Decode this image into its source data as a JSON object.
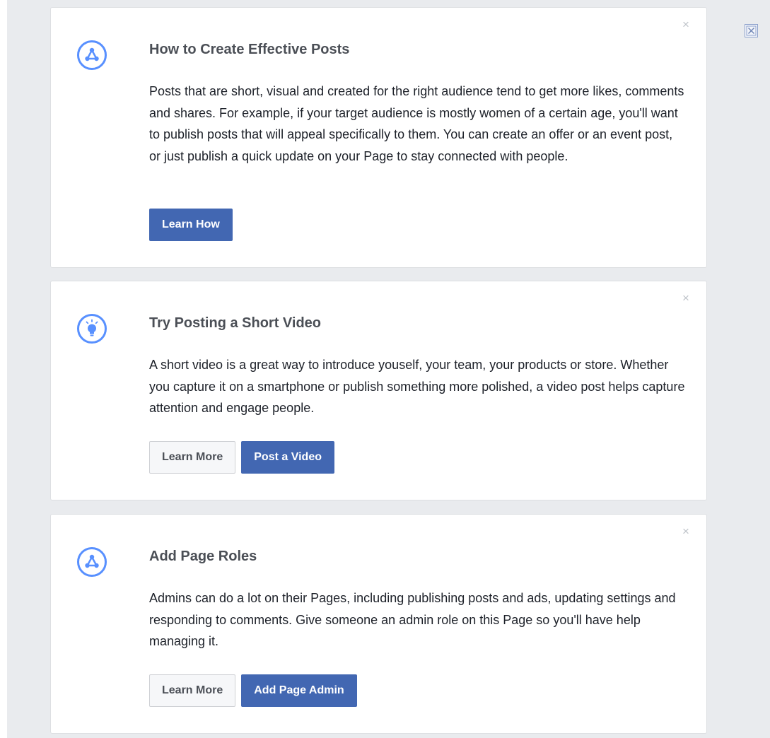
{
  "colors": {
    "background": "#e9ebee",
    "card": "#ffffff",
    "accent": "#4267b2",
    "icon_blue": "#5890ff",
    "title": "#4b4f56",
    "dismiss": "#bec3c9"
  },
  "global_close": {
    "icon": "close-box-icon"
  },
  "cards": [
    {
      "icon": "share-nodes-icon",
      "title": "How to Create Effective Posts",
      "body": "Posts that are short, visual and created for the right audience tend to get more likes, comments and shares. For example, if your target audience is mostly women of a certain age, you'll want to publish posts that will appeal specifically to them. You can create an offer or an event post, or just publish a quick update on your Page to stay connected with people.",
      "dismiss_label": "×",
      "buttons": [
        {
          "label": "Learn How",
          "style": "primary"
        }
      ]
    },
    {
      "icon": "lightbulb-icon",
      "title": "Try Posting a Short Video",
      "body": "A short video is a great way to introduce youself, your team, your products or store. Whether you capture it on a smartphone or publish something more polished, a video post helps capture attention and engage people.",
      "dismiss_label": "×",
      "buttons": [
        {
          "label": "Learn More",
          "style": "secondary"
        },
        {
          "label": "Post a Video",
          "style": "primary"
        }
      ]
    },
    {
      "icon": "share-nodes-icon",
      "title": "Add Page Roles",
      "body": "Admins can do a lot on their Pages, including publishing posts and ads, updating settings and responding to comments. Give someone an admin role on this Page so you'll have help managing it.",
      "dismiss_label": "×",
      "buttons": [
        {
          "label": "Learn More",
          "style": "secondary"
        },
        {
          "label": "Add Page Admin",
          "style": "primary"
        }
      ]
    }
  ]
}
